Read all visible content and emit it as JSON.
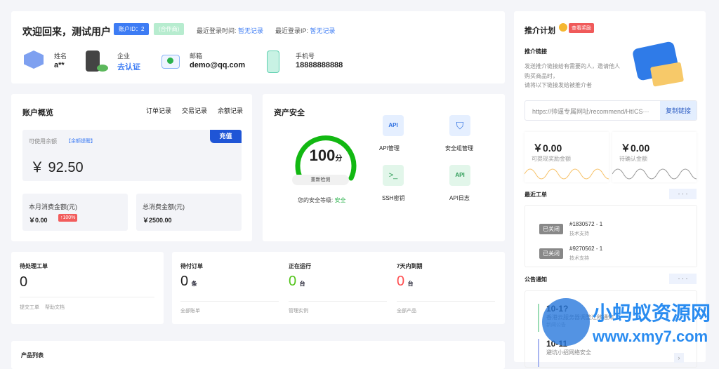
{
  "welcome": {
    "title": "欢迎回来，测试用户",
    "account_id": "账户ID：2",
    "partner": "(合作商)",
    "last_login_time_label": "最近登录时间:",
    "last_login_time": "暂无记录",
    "last_login_ip_label": "最近登录IP:",
    "last_login_ip": "暂无记录",
    "fields": [
      {
        "label": "姓名",
        "value": "a**"
      },
      {
        "label": "企业",
        "value": "去认证"
      },
      {
        "label": "邮箱",
        "value": "demo@qq.com"
      },
      {
        "label": "手机号",
        "value": "18888888888"
      }
    ]
  },
  "overview": {
    "title": "账户概览",
    "links": [
      "订单记录",
      "交易记录",
      "余额记录"
    ],
    "balance_label": "可使用余额",
    "balance_reminder": "【余额提醒】",
    "recharge": "充值",
    "balance": "￥ 92.50",
    "month_label": "本月消费金额(元)",
    "month_value": "￥0.00",
    "month_badge": "↑100%",
    "total_label": "总消费金额(元)",
    "total_value": "￥2500.00"
  },
  "security": {
    "title": "资产安全",
    "score": "100",
    "score_unit": "分",
    "score_percent": 100,
    "recheck": "重新检测",
    "level_label": "您的安全等级:",
    "level": "安全",
    "tools": [
      "API管理",
      "安全组管理",
      "SSH密钥",
      "API日志"
    ]
  },
  "tickets": {
    "title": "待处理工单",
    "count": "0",
    "links": [
      "提交工单",
      "帮助文档"
    ]
  },
  "stats": [
    {
      "title": "待付订单",
      "value": "0",
      "unit": "条",
      "link": "全部账单",
      "color": "#222"
    },
    {
      "title": "正在运行",
      "value": "0",
      "unit": "台",
      "link": "管理实例",
      "color": "#52c41a"
    },
    {
      "title": "7天内到期",
      "value": "0",
      "unit": "台",
      "link": "全部产品",
      "color": "#ff4d4f"
    }
  ],
  "products": {
    "title": "产品列表"
  },
  "referral": {
    "title": "推介计划",
    "reward_badge": "查看奖励",
    "link_title": "推介链接",
    "desc": [
      "发送推介链接给有需要的人，邀请他人",
      "购买商品时，",
      "请将以下链接发给被推介者"
    ],
    "url": "https://帅逼专属网址/recommend/HtICS···",
    "copy": "复制链接",
    "withdrawable": "￥0.00",
    "withdrawable_label": "可提现奖励金额",
    "pending": "￥0.00",
    "pending_label": "待确认金额"
  },
  "recent_tickets": {
    "title": "最近工单",
    "more": "· · ·",
    "items": [
      {
        "status": "已关闭",
        "id": "#1830572 - 1",
        "type": "技术支持"
      },
      {
        "status": "已关闭",
        "id": "#9270562 - 1",
        "type": "技术支持"
      }
    ]
  },
  "notices": {
    "title": "公告通知",
    "more": "· · ·",
    "items": [
      {
        "date": "10-1?",
        "title": "香港云服务器调整迁移通知",
        "tag": "新闻公告"
      },
      {
        "date": "10-11",
        "title": "避坑小招网络安全"
      }
    ]
  },
  "watermark": {
    "name": "小蚂蚁资源网",
    "url": "www.xmy7.com"
  }
}
